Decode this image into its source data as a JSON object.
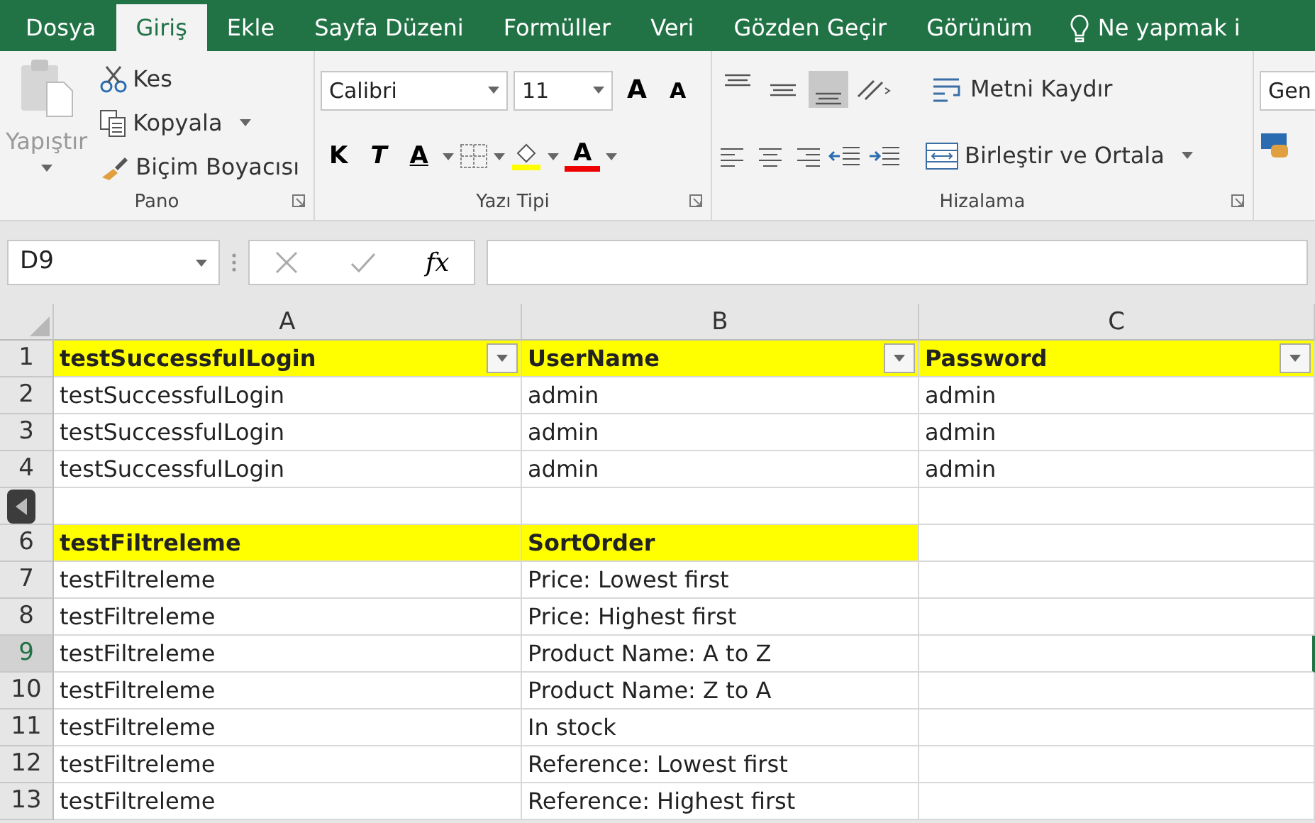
{
  "tabs": [
    {
      "label": "Dosya",
      "selected": false
    },
    {
      "label": "Giriş",
      "selected": true
    },
    {
      "label": "Ekle",
      "selected": false
    },
    {
      "label": "Sayfa Düzeni",
      "selected": false
    },
    {
      "label": "Formüller",
      "selected": false
    },
    {
      "label": "Veri",
      "selected": false
    },
    {
      "label": "Gözden Geçir",
      "selected": false
    },
    {
      "label": "Görünüm",
      "selected": false
    }
  ],
  "tell_me": "Ne yapmak i",
  "clipboard": {
    "paste": "Yapıştır",
    "cut": "Kes",
    "copy": "Kopyala",
    "format_painter": "Biçim Boyacısı",
    "label": "Pano"
  },
  "font": {
    "name": "Calibri",
    "size": "11",
    "grow": "A",
    "shrink": "A",
    "bold": "K",
    "italic": "T",
    "underline": "A",
    "font_color": "A",
    "label": "Yazı Tipi"
  },
  "alignment": {
    "vertical": [
      {
        "selected": false
      },
      {
        "selected": false
      },
      {
        "selected": true
      }
    ],
    "wrap": "Metni Kaydır",
    "merge": "Birleştir ve Ortala",
    "label": "Hizalama"
  },
  "number": {
    "format": "Gen"
  },
  "formula_bar": {
    "name_box": "D9",
    "fx": "fx"
  },
  "sheet": {
    "columns": [
      "A",
      "B",
      "C"
    ],
    "rows": [
      {
        "number": "1",
        "selected": false,
        "cells": [
          {
            "text": "testSuccessfulLogin",
            "bold": true,
            "highlighted": true,
            "filter": true
          },
          {
            "text": "UserName",
            "bold": true,
            "highlighted": true,
            "filter": true
          },
          {
            "text": "Password",
            "bold": true,
            "highlighted": true,
            "filter": true
          }
        ]
      },
      {
        "number": "2",
        "selected": false,
        "cells": [
          {
            "text": "testSuccessfulLogin",
            "bold": false,
            "highlighted": false,
            "filter": false
          },
          {
            "text": "admin",
            "bold": false,
            "highlighted": false,
            "filter": false
          },
          {
            "text": "admin",
            "bold": false,
            "highlighted": false,
            "filter": false
          }
        ]
      },
      {
        "number": "3",
        "selected": false,
        "cells": [
          {
            "text": "testSuccessfulLogin",
            "bold": false,
            "highlighted": false,
            "filter": false
          },
          {
            "text": "admin",
            "bold": false,
            "highlighted": false,
            "filter": false
          },
          {
            "text": "admin",
            "bold": false,
            "highlighted": false,
            "filter": false
          }
        ]
      },
      {
        "number": "4",
        "selected": false,
        "cells": [
          {
            "text": "testSuccessfulLogin",
            "bold": false,
            "highlighted": false,
            "filter": false
          },
          {
            "text": "admin",
            "bold": false,
            "highlighted": false,
            "filter": false
          },
          {
            "text": "admin",
            "bold": false,
            "highlighted": false,
            "filter": false
          }
        ]
      },
      {
        "selected": false,
        "cells": [
          {
            "highlighted": false,
            "filter": false
          },
          {
            "highlighted": false,
            "filter": false
          },
          {
            "highlighted": false,
            "filter": false
          }
        ]
      },
      {
        "number": "6",
        "selected": false,
        "cells": [
          {
            "text": "testFiltreleme",
            "bold": true,
            "highlighted": true,
            "filter": false
          },
          {
            "text": "SortOrder",
            "bold": true,
            "highlighted": true,
            "filter": false
          },
          {
            "highlighted": false,
            "filter": false
          }
        ]
      },
      {
        "number": "7",
        "selected": false,
        "cells": [
          {
            "text": "testFiltreleme",
            "bold": false,
            "highlighted": false,
            "filter": false
          },
          {
            "text": "Price: Lowest first",
            "bold": false,
            "highlighted": false,
            "filter": false
          },
          {
            "highlighted": false,
            "filter": false
          }
        ]
      },
      {
        "number": "8",
        "selected": false,
        "cells": [
          {
            "text": "testFiltreleme",
            "bold": false,
            "highlighted": false,
            "filter": false
          },
          {
            "text": "Price: Highest first",
            "bold": false,
            "highlighted": false,
            "filter": false
          },
          {
            "highlighted": false,
            "filter": false
          }
        ]
      },
      {
        "number": "9",
        "selected": true,
        "cells": [
          {
            "text": "testFiltreleme",
            "bold": false,
            "highlighted": false,
            "filter": false
          },
          {
            "text": "Product Name: A to Z",
            "bold": false,
            "highlighted": false,
            "filter": false
          },
          {
            "highlighted": false,
            "filter": false
          }
        ]
      },
      {
        "number": "10",
        "selected": false,
        "cells": [
          {
            "text": "testFiltreleme",
            "bold": false,
            "highlighted": false,
            "filter": false
          },
          {
            "text": "Product Name: Z to A",
            "bold": false,
            "highlighted": false,
            "filter": false
          },
          {
            "highlighted": false,
            "filter": false
          }
        ]
      },
      {
        "number": "11",
        "selected": false,
        "cells": [
          {
            "text": "testFiltreleme",
            "bold": false,
            "highlighted": false,
            "filter": false
          },
          {
            "text": "In stock",
            "bold": false,
            "highlighted": false,
            "filter": false
          },
          {
            "highlighted": false,
            "filter": false
          }
        ]
      },
      {
        "number": "12",
        "selected": false,
        "cells": [
          {
            "text": "testFiltreleme",
            "bold": false,
            "highlighted": false,
            "filter": false
          },
          {
            "text": "Reference: Lowest first",
            "bold": false,
            "highlighted": false,
            "filter": false
          },
          {
            "highlighted": false,
            "filter": false
          }
        ]
      },
      {
        "number": "13",
        "selected": false,
        "cells": [
          {
            "text": "testFiltreleme",
            "bold": false,
            "highlighted": false,
            "filter": false
          },
          {
            "text": "Reference: Highest first",
            "bold": false,
            "highlighted": false,
            "filter": false
          },
          {
            "highlighted": false,
            "filter": false
          }
        ]
      }
    ]
  }
}
